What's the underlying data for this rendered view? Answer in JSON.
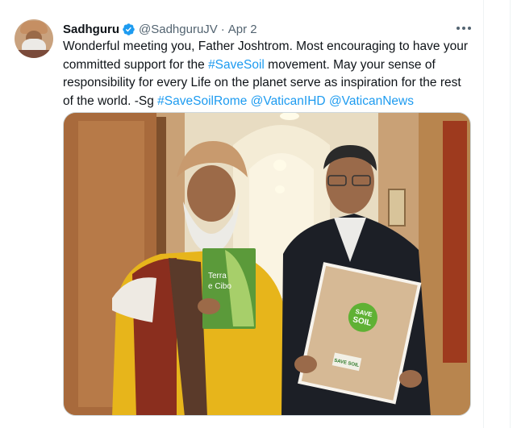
{
  "tweet": {
    "author_name": "Sadhguru",
    "handle": "@SadhguruJV",
    "separator": "·",
    "date": "Apr 2",
    "text_1": "Wonderful meeting you, Father Joshtrom. Most encouraging to have your committed support for the ",
    "hashtag_savesoil": "#SaveSoil",
    "text_2": " movement. May your sense of responsibility for every Life on the planet serve as inspiration for the rest of the world. -Sg ",
    "hashtag_savesoilrome": "#SaveSoilRome",
    "mention_vaticanihd": "@VaticanIHD",
    "mention_vaticannews": "@VaticanNews"
  },
  "photo": {
    "book_title_1": "Terra",
    "book_title_2": "e Cibo",
    "box_badge_1": "SAVE",
    "box_badge_2": "SOIL",
    "box_label": "SAVE SOIL"
  },
  "colors": {
    "link": "#1d9bf0",
    "secondary_text": "#536471",
    "verified_badge": "#1d9bf0"
  }
}
